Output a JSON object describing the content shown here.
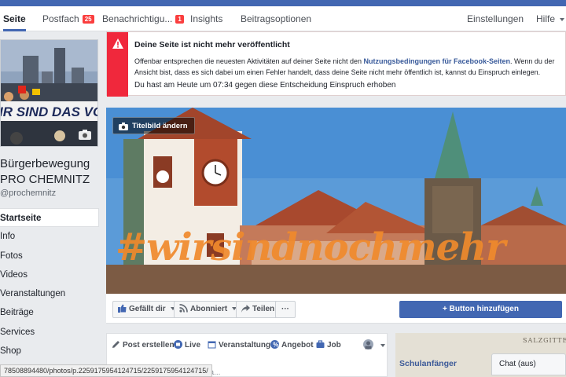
{
  "nav": {
    "items": [
      {
        "label": "Seite",
        "active": true
      },
      {
        "label": "Postfach",
        "badge": "25"
      },
      {
        "label": "Benachrichtigu...",
        "badge": "1"
      },
      {
        "label": "Insights"
      },
      {
        "label": "Beitragsoptionen"
      }
    ],
    "settings": "Einstellungen",
    "help": "Hilfe"
  },
  "profile": {
    "banner_text": "IR SIND DAS VOLK",
    "name_line1": "Bürgerbewegung",
    "name_line2": "PRO CHEMNITZ",
    "handle": "@prochemnitz"
  },
  "left_menu": [
    {
      "label": "Startseite",
      "active": true
    },
    {
      "label": "Info"
    },
    {
      "label": "Fotos"
    },
    {
      "label": "Videos"
    },
    {
      "label": "Veranstaltungen"
    },
    {
      "label": "Beiträge"
    },
    {
      "label": "Services"
    },
    {
      "label": "Shop"
    }
  ],
  "alert": {
    "title": "Deine Seite ist nicht mehr veröffentlicht",
    "body_before": "Offenbar entsprechen die neuesten Aktivitäten auf deiner Seite nicht den ",
    "body_link": "Nutzungsbedingungen für Facebook-Seiten",
    "body_after": ". Wenn du der Ansicht bist, dass es sich dabei um einen Fehler handelt, dass deine Seite nicht mehr öffentlich ist, kannst du Einspruch einlegen.",
    "appeal": "Du hast am Heute um 07:34 gegen diese Entscheidung Einspruch erhoben"
  },
  "cover": {
    "change_button": "Titelbild ändern",
    "hashtag": "#wirsindnochmehr"
  },
  "actions": {
    "like": "Gefällt dir",
    "follow": "Abonniert",
    "share": "Teilen",
    "more": "···",
    "add_button": "+ Button hinzufügen"
  },
  "composer": {
    "tabs": [
      "Post erstellen",
      "Live",
      "Veranstaltung",
      "Angebot",
      "Job"
    ],
    "placeholder": "Beitra..."
  },
  "teaser": {
    "brand": "SALZGITTER",
    "headline": "Schulanfänger"
  },
  "chat": "Chat (aus)",
  "status_url": "78508894480/photos/p.2259175954124715/2259175954124715/",
  "colors": {
    "brand": "#4267b2",
    "alert_red": "#f0283c",
    "hashtag": "#f08a2c"
  }
}
